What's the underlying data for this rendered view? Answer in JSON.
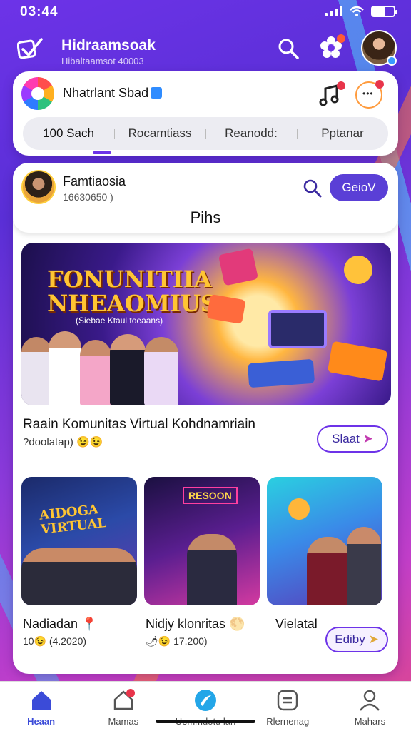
{
  "status": {
    "time": "03:44"
  },
  "header": {
    "title": "Hidraamsoak",
    "subtitle": "Hibaltaamsot 40003"
  },
  "community": {
    "name": "Nhatrlant Sbad",
    "tabs": [
      {
        "label": "100 Sach"
      },
      {
        "label": "Rocamtiass"
      },
      {
        "label": "Reanodd:"
      },
      {
        "label": "Pptanar"
      }
    ]
  },
  "user": {
    "name": "Famtiaosia",
    "count": "16630650 )",
    "action_label": "GeioV"
  },
  "section": {
    "title": "Pihs"
  },
  "banner": {
    "title_line1": "FONUNITIIA",
    "title_line2": "NHEAOMIUS",
    "subtitle": "(Siebae Ktaul toeaans)"
  },
  "post": {
    "title": "Raain Komunitas Virtual Kohdnamriain",
    "meta": "?doolatap) 😉😉",
    "start_label": "Slaat"
  },
  "thumbnails": [
    {
      "label": "Nadiadan 📍",
      "meta": "10😉 (4.2020)",
      "thumb_title": "AIDOGA VIRTUAL"
    },
    {
      "label": "Nidjy klonritas 🌕",
      "meta": "🌶😉 17.200)",
      "thumb_title": "RESOON"
    },
    {
      "label": "Vielatal",
      "meta": "",
      "thumb_title": ""
    }
  ],
  "buy_label": "Ediby",
  "bottom_nav": [
    {
      "label": "Heaan"
    },
    {
      "label": "Mamas"
    },
    {
      "label": "Uemmdotu lan"
    },
    {
      "label": "Rlernenag"
    },
    {
      "label": "Mahars"
    }
  ],
  "colors": {
    "accent": "#5a3fd6",
    "background_top": "#6d33e8",
    "background_bottom": "#e0488a",
    "nav_active": "#3b4bd8"
  }
}
